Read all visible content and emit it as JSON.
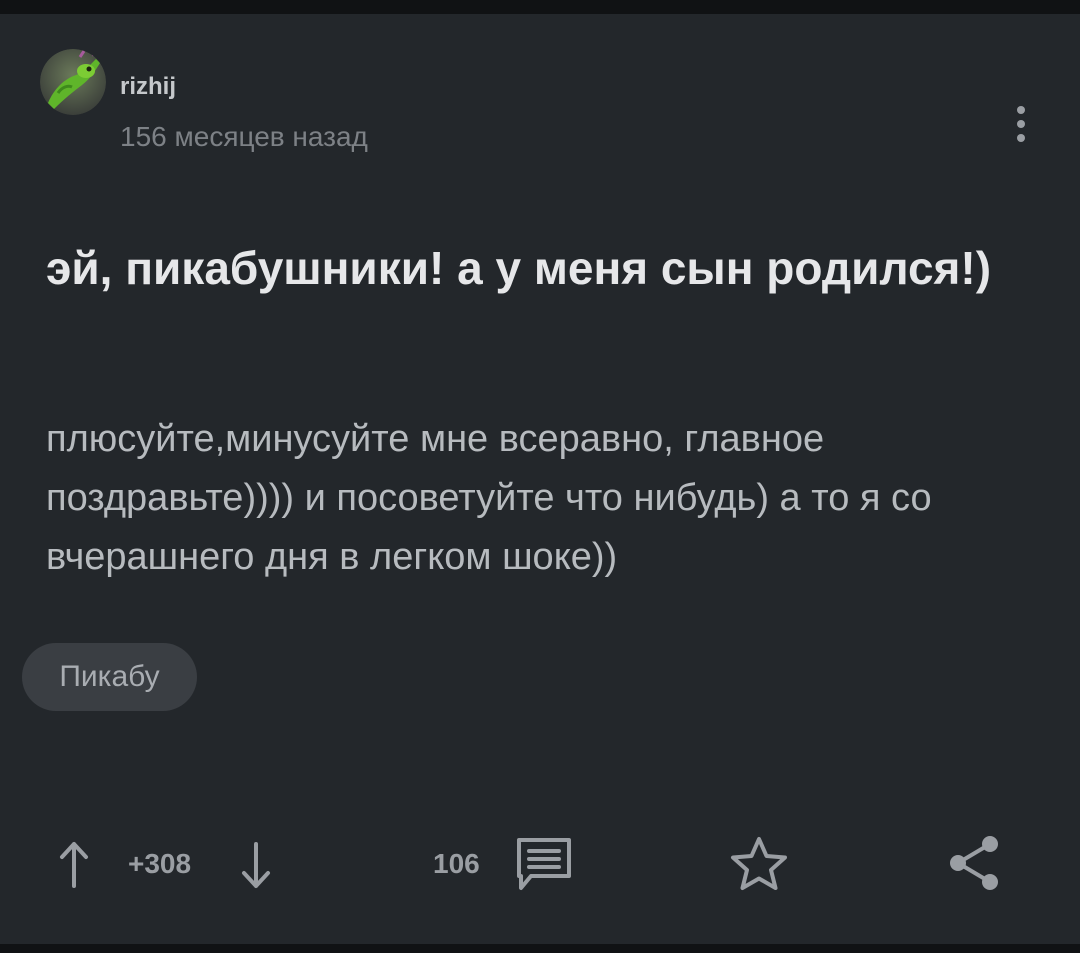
{
  "post": {
    "author": "rizhij",
    "time": "156 месяцев назад",
    "title": "эй, пикабушники! а у меня сын родился!)",
    "body": "плюсуйте,минусуйте мне всеравно, главное поздравьте)))) и посоветуйте что нибудь) а то я со вчерашнего дня в легком шоке))",
    "tag": "Пикабу"
  },
  "actions": {
    "rating": "+308",
    "comments_count": "106"
  },
  "colors": {
    "background": "#23272b",
    "title": "#e6e7e9",
    "body": "#b7bbbf",
    "meta": "#7d8186",
    "icon": "#9a9ea3",
    "tag_bg": "#3a3e43"
  },
  "icons": {
    "avatar": "green-chameleon-avatar",
    "menu": "more-vertical-icon",
    "upvote": "arrow-up-icon",
    "downvote": "arrow-down-icon",
    "comments": "comment-icon",
    "save": "star-icon",
    "share": "share-icon"
  }
}
